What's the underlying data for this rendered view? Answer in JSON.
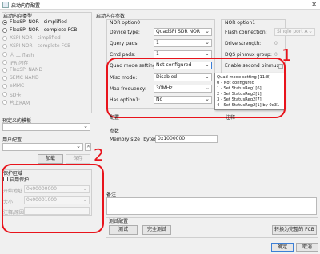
{
  "window": {
    "title": "启动内存配置",
    "close_glyph": "✕"
  },
  "boot_type": {
    "title": "启动内存类型",
    "options": [
      {
        "label": "FlexSPI NOR - simplified",
        "selected": true,
        "enabled": true
      },
      {
        "label": "FlexSPI NOR - complete FCB",
        "selected": false,
        "enabled": true
      },
      {
        "label": "XSPI NOR - simplified",
        "selected": false,
        "enabled": false
      },
      {
        "label": "XSPI NOR - complete FCB",
        "selected": false,
        "enabled": false
      },
      {
        "label": "人 上 flash",
        "selected": false,
        "enabled": false
      },
      {
        "label": "IFR 闪存",
        "selected": false,
        "enabled": false
      },
      {
        "label": "FlexSPI NAND",
        "selected": false,
        "enabled": false
      },
      {
        "label": "SEMC NAND",
        "selected": false,
        "enabled": false
      },
      {
        "label": "eMMC",
        "selected": false,
        "enabled": false
      },
      {
        "label": "SD卡",
        "selected": false,
        "enabled": false
      },
      {
        "label": "片上RAM",
        "selected": false,
        "enabled": false
      }
    ]
  },
  "template": {
    "label": "预定义的模板",
    "value": ""
  },
  "user_config": {
    "label": "用户配置",
    "value": "",
    "load_label": "加载",
    "save_label": "保存"
  },
  "protect": {
    "title": "保护区域",
    "enable_label": "启用保护",
    "start_label": "开始地址",
    "start_value": "0x00000000",
    "size_label": "大小",
    "size_value": "0x00001000",
    "note_label": "注释/原因",
    "note_value": ""
  },
  "boot_params": {
    "title": "启动内存参数"
  },
  "option0": {
    "title": "NOR option0",
    "device_type_label": "Device type:",
    "device_type_value": "QuadSPI SDR NOR",
    "query_pads_label": "Query pads:",
    "query_pads_value": "1",
    "cmd_pads_label": "Cmd pads:",
    "cmd_pads_value": "1",
    "quad_mode_label": "Quad mode setting:",
    "quad_mode_value": "Not configured",
    "misc_mode_label": "Misc mode:",
    "misc_mode_value": "Disabled",
    "max_freq_label": "Max frequency:",
    "max_freq_value": "30MHz",
    "has_option1_label": "Has option1:",
    "has_option1_value": "No"
  },
  "option1": {
    "title": "NOR option1",
    "flash_conn_label": "Flash connection:",
    "flash_conn_value": "Single port A",
    "drive_strength_label": "Drive strength:",
    "drive_strength_value": "0",
    "dqs_group_label": "DQS pinmux group:",
    "dqs_group_value": "0",
    "second_pinmux_label": "Enable second pinmux:"
  },
  "tooltip": {
    "lines": [
      "Quad mode setting [11:8]",
      "0 - Not configured",
      "1 - Set StatusReg1[6]",
      "2 - Set StatusReg2[1]",
      "3 - Set StatusReg2[7]",
      "4 - Set StatusReg2[1] by 0x31"
    ]
  },
  "partial": {
    "left_label": "配置",
    "right_label": "注释"
  },
  "params": {
    "title": "参数",
    "mem_size_label": "Memory size [bytes]:",
    "mem_size_value": "0x1000000"
  },
  "notes": {
    "label": "备注",
    "value": ""
  },
  "test": {
    "title": "测试配置",
    "test_label": "测试",
    "full_test_label": "完全测试",
    "convert_label": "转换为完整的 FCB"
  },
  "footer": {
    "ok_label": "确定",
    "cancel_label": "取消"
  },
  "annotations": {
    "one": "1",
    "two": "2"
  }
}
